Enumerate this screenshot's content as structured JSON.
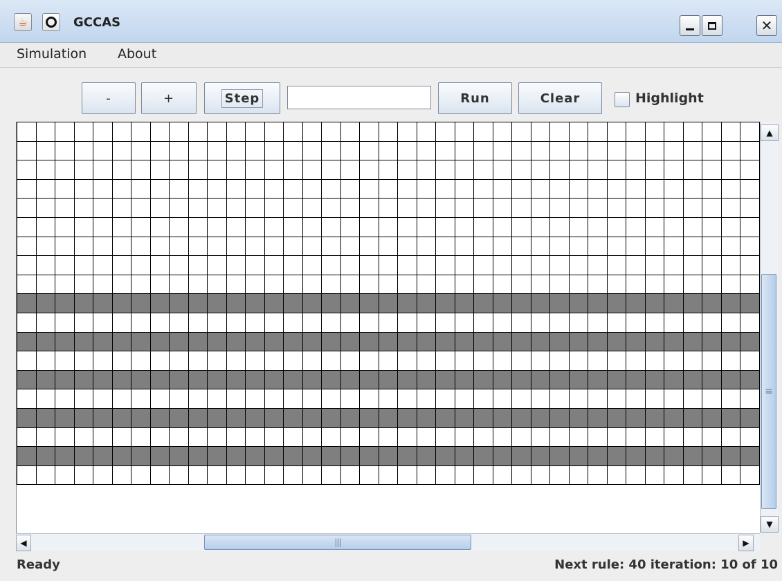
{
  "window": {
    "title": "GCCAS",
    "app_icon": "java-icon",
    "secondary_icon": "ring-icon",
    "close_label": "✕"
  },
  "menu": {
    "items": [
      {
        "label": "Simulation"
      },
      {
        "label": "About"
      }
    ]
  },
  "toolbar": {
    "minus_label": "-",
    "plus_label": "+",
    "step_label": "Step",
    "input_value": "",
    "run_label": "Run",
    "clear_label": "Clear",
    "highlight_label": "Highlight",
    "highlight_checked": false
  },
  "grid": {
    "columns": 39,
    "visible_rows": 19,
    "filled_rows": [
      9,
      11,
      13,
      15,
      17
    ],
    "filled_color": "#7f7f7f",
    "empty_color": "#ffffff"
  },
  "scrollbars": {
    "vertical_thumb_grip": "≡",
    "horizontal_thumb_grip": "|||"
  },
  "status": {
    "left": "Ready",
    "right": "Next rule: 40 iteration: 10 of 10"
  }
}
